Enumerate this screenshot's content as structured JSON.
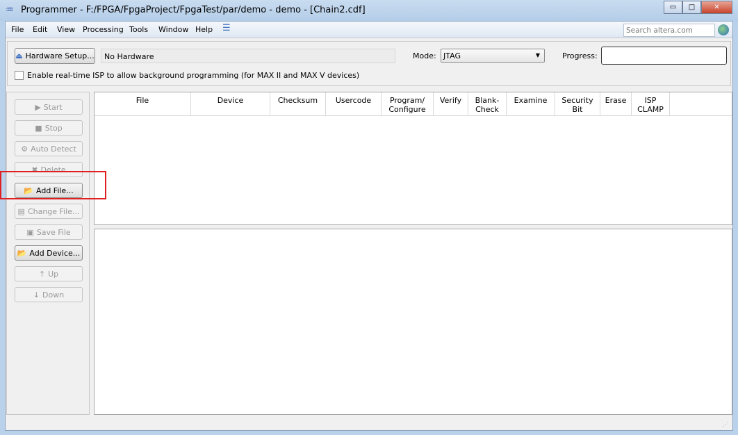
{
  "window": {
    "title": "Programmer - F:/FPGA/FpgaProject/FpgaTest/par/demo - demo - [Chain2.cdf]",
    "minimize": "▭",
    "maximize": "□",
    "close": "✕"
  },
  "menu": [
    "File",
    "Edit",
    "View",
    "Processing",
    "Tools",
    "Window",
    "Help"
  ],
  "search": {
    "placeholder": "Search altera.com"
  },
  "toolbar": {
    "hardware_setup": "Hardware Setup...",
    "hardware_value": "No Hardware",
    "mode_label": "Mode:",
    "mode_value": "JTAG",
    "progress_label": "Progress:",
    "isp_checkbox_label": "Enable real-time ISP to allow background programming (for MAX II and MAX V devices)",
    "isp_checked": false,
    "progress_value": 0
  },
  "side_buttons": [
    {
      "label": "Start",
      "enabled": false,
      "icon": "start-icon"
    },
    {
      "label": "Stop",
      "enabled": false,
      "icon": "stop-icon"
    },
    {
      "label": "Auto Detect",
      "enabled": false,
      "icon": "auto-detect-icon"
    },
    {
      "label": "Delete",
      "enabled": false,
      "icon": "delete-icon"
    },
    {
      "label": "Add File...",
      "enabled": true,
      "icon": "folder-icon"
    },
    {
      "label": "Change File...",
      "enabled": false,
      "icon": "change-file-icon"
    },
    {
      "label": "Save File",
      "enabled": false,
      "icon": "save-icon"
    },
    {
      "label": "Add Device...",
      "enabled": true,
      "icon": "add-device-icon"
    },
    {
      "label": "Up",
      "enabled": false,
      "icon": "up-arrow-icon"
    },
    {
      "label": "Down",
      "enabled": false,
      "icon": "down-arrow-icon"
    }
  ],
  "table": {
    "columns": [
      "File",
      "Device",
      "Checksum",
      "Usercode",
      "Program/\nConfigure",
      "Verify",
      "Blank-\nCheck",
      "Examine",
      "Security\nBit",
      "Erase",
      "ISP\nCLAMP"
    ],
    "rows": []
  },
  "colors": {
    "highlight": "#e02020",
    "titlebar": "#b9d1ea"
  }
}
